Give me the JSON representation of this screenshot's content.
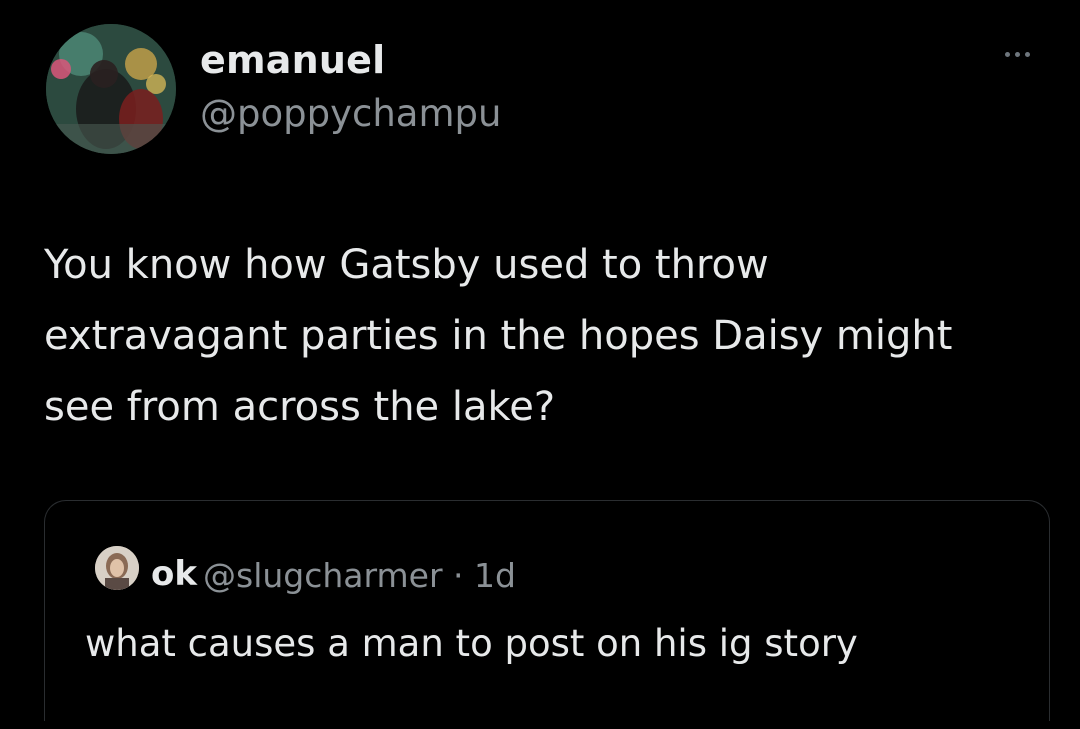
{
  "author": {
    "display_name": "emanuel",
    "handle": "@poppychampu",
    "avatar_icon": "profile-photo"
  },
  "tweet": {
    "text": "You know how Gatsby used to throw\nextravagant parties in the hopes Daisy might\nsee from across the lake?"
  },
  "menu": {
    "icon": "more-options-icon"
  },
  "quoted_tweet": {
    "display_name": "ok",
    "meta": "@slugcharmer · 1d",
    "text": "what causes a man to post on his ig story",
    "avatar_icon": "profile-photo"
  },
  "colors": {
    "background": "#000000",
    "primary_text": "#e7e9ea",
    "secondary_text": "#8b9196",
    "border": "#2a2d30"
  }
}
